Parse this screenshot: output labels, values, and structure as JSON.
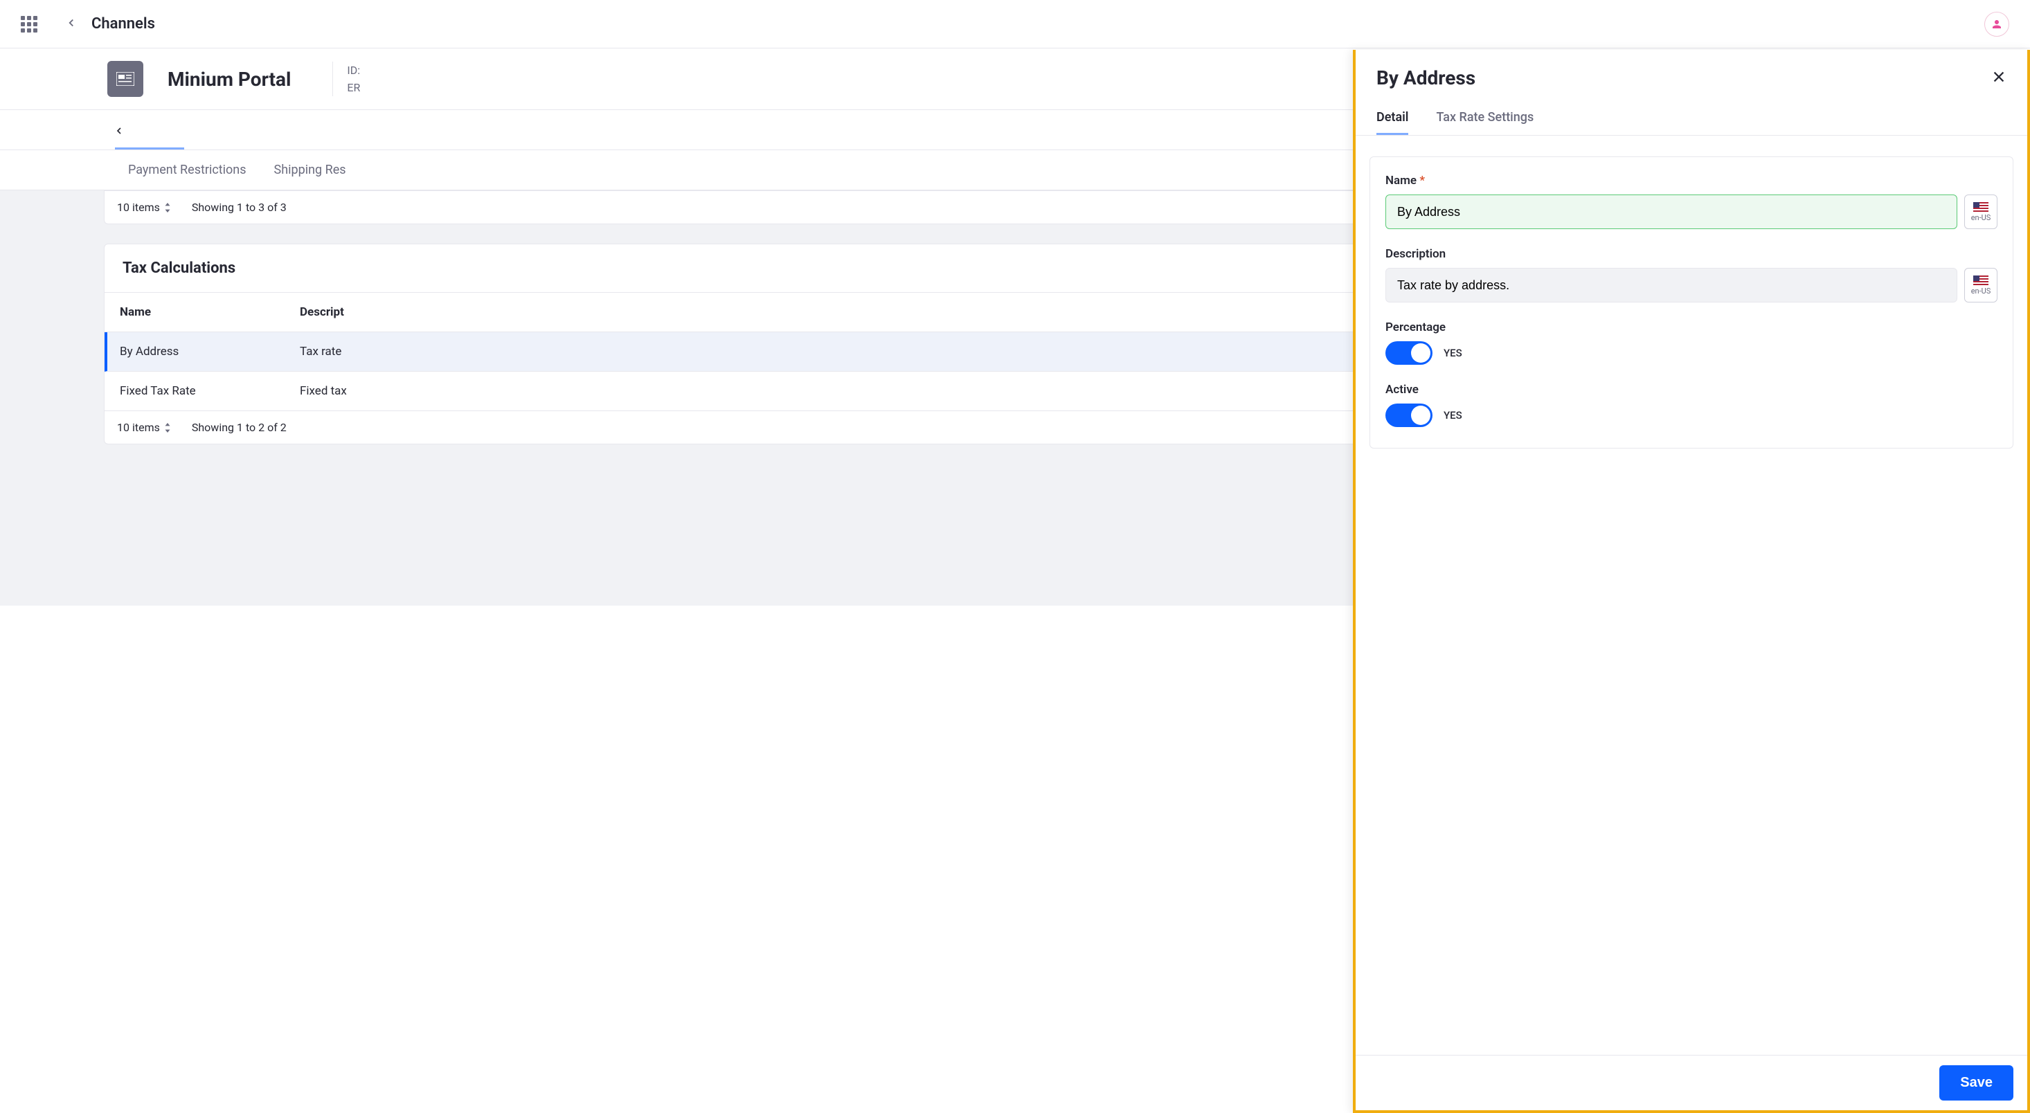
{
  "topbar": {
    "title": "Channels"
  },
  "header": {
    "portal_title": "Minium Portal",
    "id_label": "ID:",
    "erp_label": "ER"
  },
  "tabs": {
    "payment_restrictions": "Payment Restrictions",
    "shipping_restrictions": "Shipping Res"
  },
  "list_card": {
    "items_per_page": "10 items",
    "showing": "Showing 1 to 3 of 3"
  },
  "tax_card": {
    "title": "Tax Calculations",
    "columns": {
      "name": "Name",
      "description": "Descript"
    },
    "rows": [
      {
        "name": "By Address",
        "description": "Tax rate"
      },
      {
        "name": "Fixed Tax Rate",
        "description": "Fixed tax"
      }
    ],
    "items_per_page": "10 items",
    "showing": "Showing 1 to 2 of 2"
  },
  "panel": {
    "title": "By Address",
    "tabs": {
      "detail": "Detail",
      "tax_rate_settings": "Tax Rate Settings"
    },
    "form": {
      "name_label": "Name",
      "name_value": "By Address",
      "description_label": "Description",
      "description_value": "Tax rate by address.",
      "percentage_label": "Percentage",
      "percentage_value": "YES",
      "active_label": "Active",
      "active_value": "YES",
      "locale": "en-US"
    },
    "save": "Save"
  }
}
